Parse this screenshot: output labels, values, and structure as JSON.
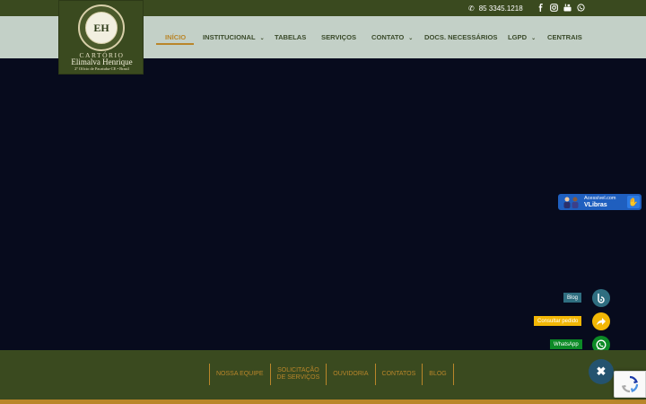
{
  "topbar": {
    "phone": "85 3345.1218",
    "phone_icon": "phone-icon",
    "social": [
      "facebook-icon",
      "instagram-icon",
      "youtube-icon",
      "whatsapp-icon"
    ]
  },
  "logo": {
    "monogram": "EH",
    "name_line1": "CARTÓRIO",
    "name_line2": "Elimalva Henrique",
    "subline": "2º Ofício de Pacatuba-CE • Brasil"
  },
  "nav": {
    "items": [
      {
        "label": "INÍCIO",
        "active": true,
        "dropdown": false
      },
      {
        "label": "INSTITUCIONAL",
        "active": false,
        "dropdown": true
      },
      {
        "label": "TABELAS",
        "active": false,
        "dropdown": false
      },
      {
        "label": "SERVIÇOS",
        "active": false,
        "dropdown": false
      },
      {
        "label": "CONTATO",
        "active": false,
        "dropdown": true
      },
      {
        "label": "DOCS. NECESSÁRIOS",
        "active": false,
        "dropdown": false
      },
      {
        "label": "LGPD",
        "active": false,
        "dropdown": true
      },
      {
        "label": "CENTRAIS",
        "active": false,
        "dropdown": false
      }
    ]
  },
  "vlibras": {
    "line1": "Acessível.com",
    "line2": "VLibras"
  },
  "floating": {
    "blog_label": "Blog",
    "consultar_label": "Consultar pedido",
    "whatsapp_label": "WhatsApp",
    "close_symbol": "✖"
  },
  "footer": {
    "links": [
      "NOSSA EQUIPE",
      "SOLICITAÇÃO\nDE SERVIÇOS",
      "OUVIDORIA",
      "CONTATOS",
      "BLOG"
    ]
  },
  "colors": {
    "topbar": "#3a4a1f",
    "navbar": "#c3d0c7",
    "accent_gold": "#b9862a",
    "hero": "#070b1d",
    "blog_teal": "#2f6e80",
    "consultar_yellow": "#f2b705",
    "whatsapp_green": "#0c8a26"
  }
}
